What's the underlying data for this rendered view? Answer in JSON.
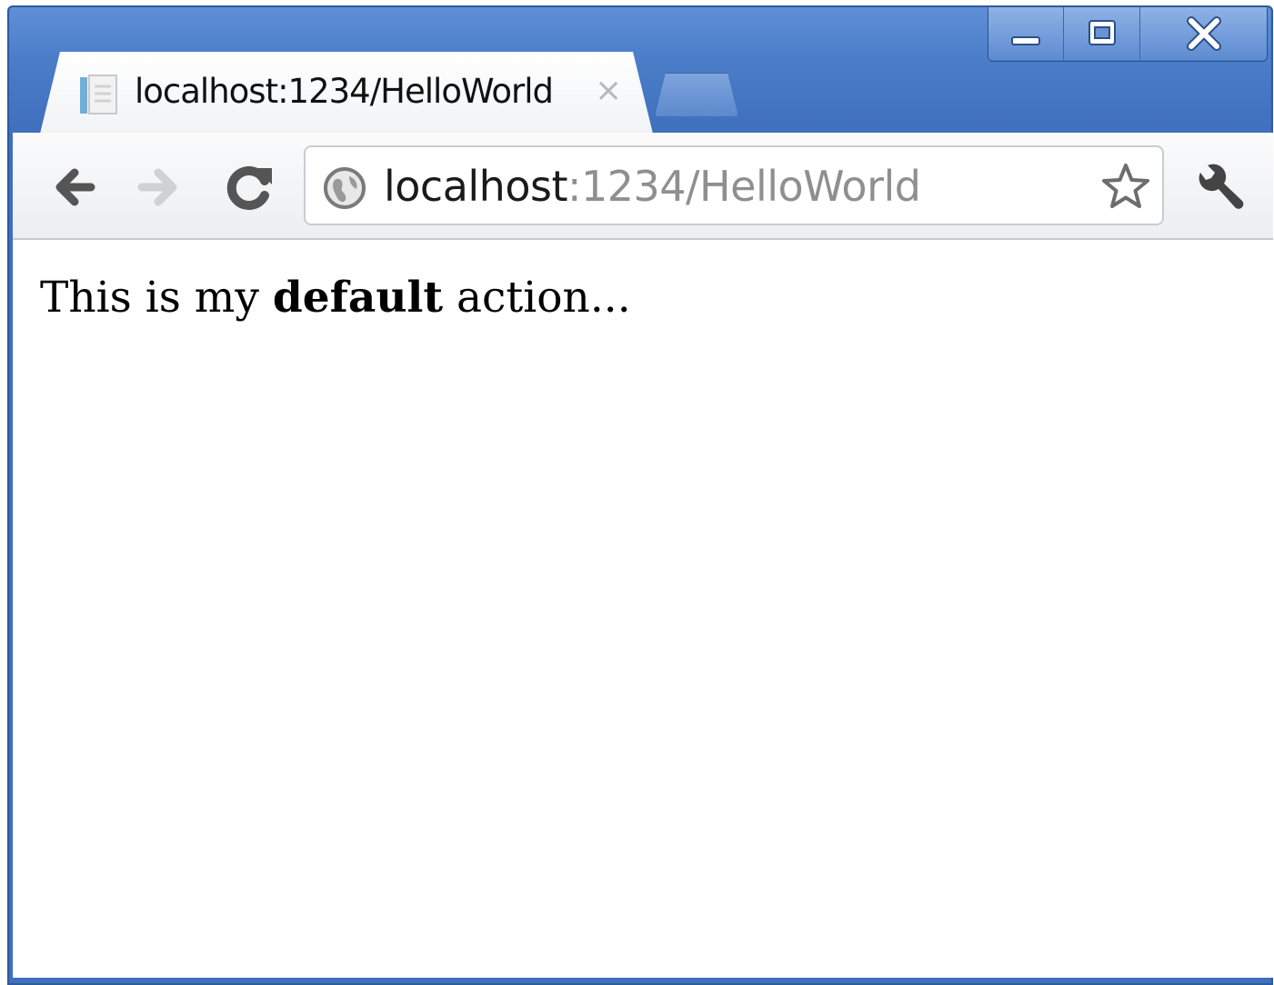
{
  "tab": {
    "title": "localhost:1234/HelloWorld",
    "close": "×"
  },
  "omnibox": {
    "host": "localhost",
    "path": ":1234/HelloWorld"
  },
  "content": {
    "prefix": "This is my ",
    "bold": "default",
    "suffix": " action..."
  },
  "icons": {
    "favicon": "page-icon",
    "back": "back-arrow-icon",
    "forward": "forward-arrow-icon",
    "reload": "reload-icon",
    "site": "globe-icon",
    "bookmark": "star-icon",
    "menu": "wrench-icon",
    "minimize": "minimize-icon",
    "maximize": "maximize-icon",
    "close": "close-icon"
  },
  "colors": {
    "frame": "#4a7cc8",
    "url_path": "#8f8f8f"
  }
}
